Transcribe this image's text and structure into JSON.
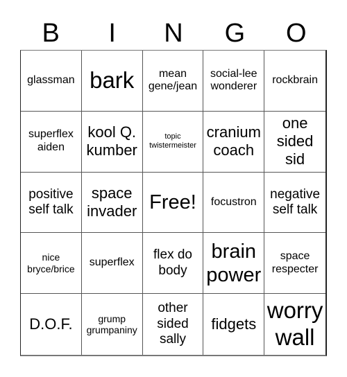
{
  "header": [
    "B",
    "I",
    "N",
    "G",
    "O"
  ],
  "cells": [
    {
      "text": "glassman",
      "size": "s-md"
    },
    {
      "text": "bark",
      "size": "s-huge"
    },
    {
      "text": "mean gene/jean",
      "size": "s-md"
    },
    {
      "text": "social-lee wonderer",
      "size": "s-md"
    },
    {
      "text": "rockbrain",
      "size": "s-md"
    },
    {
      "text": "superflex aiden",
      "size": "s-md"
    },
    {
      "text": "kool Q. kumber",
      "size": "s-xl"
    },
    {
      "text": "topic twistermeister",
      "size": "s-xs"
    },
    {
      "text": "cranium coach",
      "size": "s-xl"
    },
    {
      "text": "one sided sid",
      "size": "s-xl"
    },
    {
      "text": "positive self talk",
      "size": "s-lg"
    },
    {
      "text": "space invader",
      "size": "s-xl"
    },
    {
      "text": "Free!",
      "size": "s-xxl"
    },
    {
      "text": "focustron",
      "size": "s-md"
    },
    {
      "text": "negative self talk",
      "size": "s-lg"
    },
    {
      "text": "nice bryce/brice",
      "size": "s-sm"
    },
    {
      "text": "superflex",
      "size": "s-md"
    },
    {
      "text": "flex do body",
      "size": "s-lg"
    },
    {
      "text": "brain power",
      "size": "s-xxl"
    },
    {
      "text": "space respecter",
      "size": "s-md"
    },
    {
      "text": "D.O.F.",
      "size": "s-xl"
    },
    {
      "text": "grump grumpaniny",
      "size": "s-sm"
    },
    {
      "text": "other sided sally",
      "size": "s-lg"
    },
    {
      "text": "fidgets",
      "size": "s-xl"
    },
    {
      "text": "worry wall",
      "size": "s-huge"
    }
  ]
}
